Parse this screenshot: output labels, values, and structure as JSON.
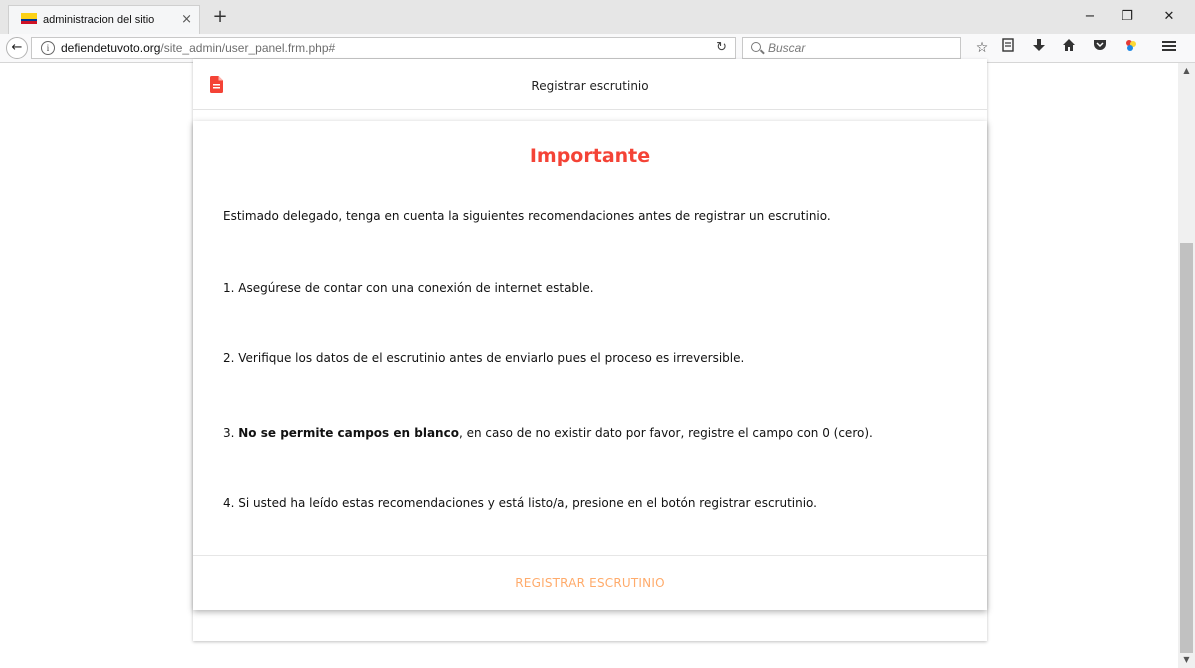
{
  "browser": {
    "tab_title": "administracion del sitio",
    "tab_close": "×",
    "new_tab": "+",
    "url_domain": "defiendetuvoto.org",
    "url_path": "/site_admin/user_panel.frm.php#",
    "search_placeholder": "Buscar",
    "window_controls": {
      "minimize": "−",
      "restore": "❐",
      "close": "✕"
    },
    "toolbar_icons": [
      "bookmark-star-icon",
      "reading-list-icon",
      "downloads-icon",
      "home-icon",
      "pocket-icon",
      "extension-icon",
      "menu-icon"
    ]
  },
  "page": {
    "header_title": "Registrar escrutinio",
    "accent_color": "#f44336",
    "button_color": "#ffab6b"
  },
  "dialog": {
    "title": "Importante",
    "intro": "Estimado delegado, tenga en cuenta la siguientes recomendaciones antes de registrar un escrutinio.",
    "items": [
      {
        "text": "1. Asegúrese de contar con una conexión de internet estable."
      },
      {
        "text": "2. Verifique los datos de el escrutinio antes de enviarlo pues el proceso es irreversible."
      },
      {
        "prefix": "3. ",
        "bold": "No se permite campos en blanco",
        "rest": ", en caso de no existir dato por favor, registre el campo con 0 (cero)."
      },
      {
        "text": "4. Si usted ha leído estas recomendaciones y está listo/a, presione en el botón registrar escrutinio."
      }
    ],
    "button_label": "REGISTRAR ESCRUTINIO"
  }
}
